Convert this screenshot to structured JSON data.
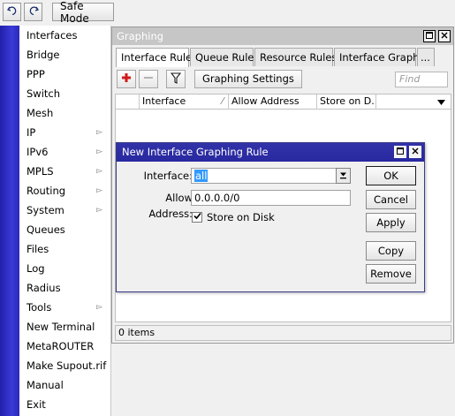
{
  "toolbar": {
    "undo_icon": "undo-icon",
    "redo_icon": "redo-icon",
    "safe_mode_label": "Safe Mode"
  },
  "menu": {
    "items": [
      {
        "label": "Interfaces",
        "submenu": false
      },
      {
        "label": "Bridge",
        "submenu": false
      },
      {
        "label": "PPP",
        "submenu": false
      },
      {
        "label": "Switch",
        "submenu": false
      },
      {
        "label": "Mesh",
        "submenu": false
      },
      {
        "label": "IP",
        "submenu": true
      },
      {
        "label": "IPv6",
        "submenu": true
      },
      {
        "label": "MPLS",
        "submenu": true
      },
      {
        "label": "Routing",
        "submenu": true
      },
      {
        "label": "System",
        "submenu": true
      },
      {
        "label": "Queues",
        "submenu": false
      },
      {
        "label": "Files",
        "submenu": false
      },
      {
        "label": "Log",
        "submenu": false
      },
      {
        "label": "Radius",
        "submenu": false
      },
      {
        "label": "Tools",
        "submenu": true
      },
      {
        "label": "New Terminal",
        "submenu": false
      },
      {
        "label": "MetaROUTER",
        "submenu": false
      },
      {
        "label": "Make Supout.rif",
        "submenu": false
      },
      {
        "label": "Manual",
        "submenu": false
      },
      {
        "label": "Exit",
        "submenu": false
      }
    ]
  },
  "graphing_window": {
    "title": "Graphing",
    "tabs": [
      "Interface Rules",
      "Queue Rules",
      "Resource Rules",
      "Interface Graphs",
      "..."
    ],
    "active_tab": 0,
    "settings_button": "Graphing Settings",
    "find_placeholder": "Find",
    "columns": [
      "Interface",
      "Allow Address",
      "Store on D..."
    ],
    "status": "0 items"
  },
  "dialog": {
    "title": "New Interface Graphing Rule",
    "interface_label": "Interface:",
    "interface_value": "all",
    "allow_address_label": "Allow Address:",
    "allow_address_value": "0.0.0.0/0",
    "store_on_disk_label": "Store on Disk",
    "store_on_disk_checked": true,
    "buttons": {
      "ok": "OK",
      "cancel": "Cancel",
      "apply": "Apply",
      "copy": "Copy",
      "remove": "Remove"
    }
  },
  "colors": {
    "dialog_title_bg": "#2828a0",
    "selection": "#3399ff",
    "add_icon": "#d11a1a",
    "side_strip": "#2a2ab8"
  }
}
